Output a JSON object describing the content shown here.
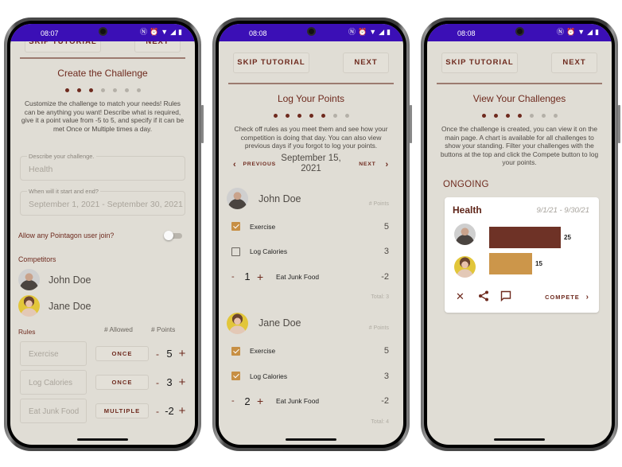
{
  "colors": {
    "statusbar": "#3b0fb6",
    "accent": "#6e2a1e",
    "gold": "#c78f44",
    "screen_bg": "#e0ddd5",
    "bar_john": "#6e3226",
    "bar_jane": "#cc964a"
  },
  "common": {
    "skip_label": "SKIP TUTORIAL",
    "next_label": "NEXT",
    "status_icons": [
      "nfc-icon",
      "alarm-icon",
      "wifi-icon",
      "signal-icon",
      "battery-icon"
    ]
  },
  "screen1": {
    "time": "08:07",
    "title": "Create the Challenge",
    "step": 3,
    "total_steps": 7,
    "description": "Customize the challenge to match your needs! Rules can be anything you want! Describe what is required, give it a point value from -5 to 5, and specify if it can be met Once or Multiple times a day.",
    "describe_label": "Describe your challenge.",
    "describe_value": "Health",
    "dates_label": "When will it start and end?",
    "dates_value": "September 1, 2021 - September 30, 2021",
    "allow_label": "Allow any Pointagon user join?",
    "allow_on": false,
    "competitors_label": "Competitors",
    "competitors": [
      {
        "name": "John Doe",
        "avatar": "john"
      },
      {
        "name": "Jane Doe",
        "avatar": "jane"
      }
    ],
    "rules_label": "Rules",
    "allowed_header": "# Allowed",
    "points_header": "# Points",
    "rules": [
      {
        "name": "Exercise",
        "allowed": "ONCE",
        "points": "5"
      },
      {
        "name": "Log Calories",
        "allowed": "ONCE",
        "points": "3"
      },
      {
        "name": "Eat Junk Food",
        "allowed": "MULTIPLE",
        "points": "-2"
      }
    ],
    "minus": "-",
    "plus": "+"
  },
  "screen2": {
    "time": "08:08",
    "title": "Log Your Points",
    "step": 5,
    "total_steps": 7,
    "description": "Check off rules as you meet them and see how your competition is doing that day. You can also view previous days if you forgot to log your points.",
    "previous_label": "PREVIOUS",
    "next_label": "NEXT",
    "date_line1": "September 15,",
    "date_line2": "2021",
    "points_header": "# Points",
    "people": [
      {
        "name": "John Doe",
        "avatar": "john",
        "rules": [
          {
            "name": "Exercise",
            "type": "check",
            "checked": true,
            "points": "5"
          },
          {
            "name": "Log Calories",
            "type": "check",
            "checked": false,
            "points": "3"
          },
          {
            "name": "Eat Junk Food",
            "type": "count",
            "count": "1",
            "points": "-2"
          }
        ],
        "total": "Total: 3"
      },
      {
        "name": "Jane Doe",
        "avatar": "jane",
        "rules": [
          {
            "name": "Exercise",
            "type": "check",
            "checked": true,
            "points": "5"
          },
          {
            "name": "Log Calories",
            "type": "check",
            "checked": true,
            "points": "3"
          },
          {
            "name": "Eat Junk Food",
            "type": "count",
            "count": "2",
            "points": "-2"
          }
        ],
        "total": "Total: 4"
      }
    ]
  },
  "screen3": {
    "time": "08:08",
    "title": "View Your Challenges",
    "step": 4,
    "total_steps": 7,
    "description": "Once the challenge is created, you can view it on the main page. A chart is available for all challenges to show your standing. Filter your challenges with the buttons at the top and click the Compete button to log your points.",
    "section": "ONGOING",
    "card": {
      "title": "Health",
      "dates": "9/1/21 - 9/30/21",
      "scores": [
        {
          "name": "John Doe",
          "avatar": "john",
          "value": 25,
          "label": "25"
        },
        {
          "name": "Jane Doe",
          "avatar": "jane",
          "value": 15,
          "label": "15"
        }
      ],
      "max_value": 25,
      "compete_label": "COMPETE"
    }
  }
}
